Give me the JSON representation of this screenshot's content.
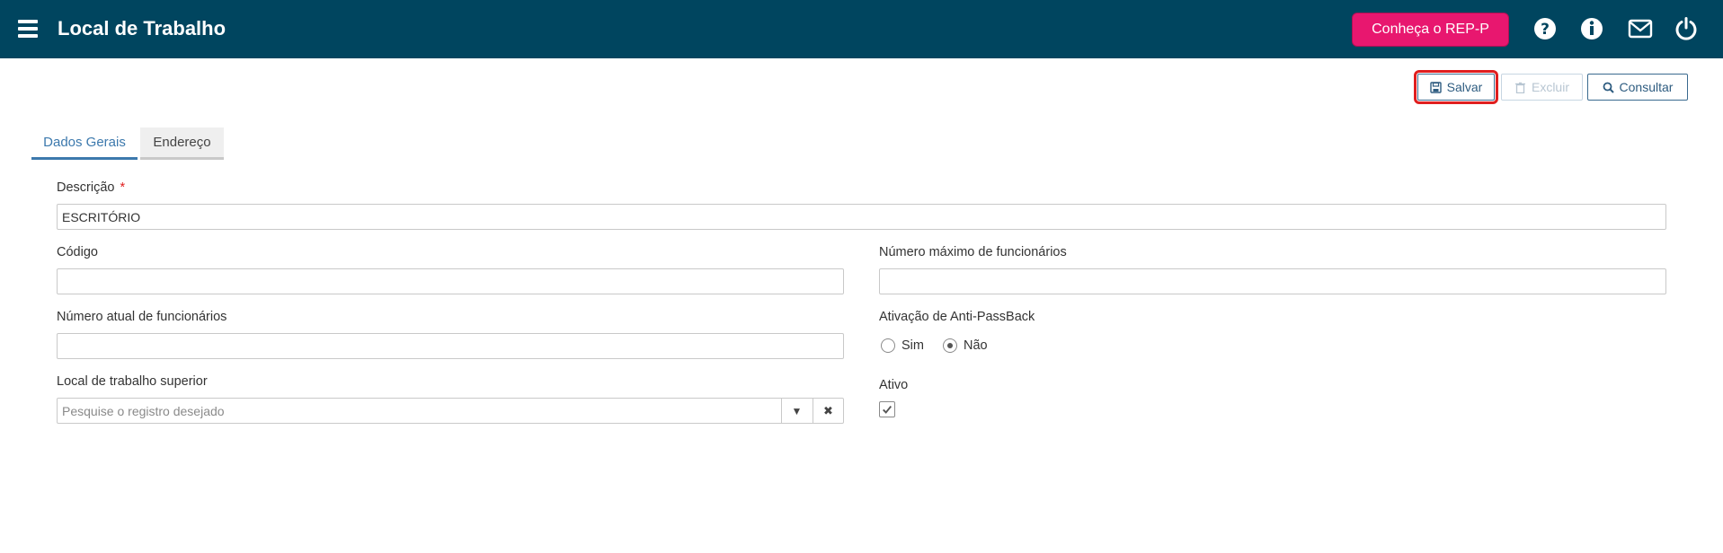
{
  "header": {
    "title": "Local de Trabalho",
    "cta_label": "Conheça o REP-P",
    "background_color": "#00455f",
    "cta_color": "#e8176f",
    "icons": [
      "menu-icon",
      "help-icon",
      "info-icon",
      "mail-icon",
      "power-icon"
    ]
  },
  "toolbar": {
    "save_label": "Salvar",
    "delete_label": "Excluir",
    "search_label": "Consultar"
  },
  "tabs": [
    {
      "label": "Dados Gerais",
      "active": true
    },
    {
      "label": "Endereço",
      "active": false
    }
  ],
  "form": {
    "descricao": {
      "label": "Descrição",
      "required_mark": "*",
      "value": "ESCRITÓRIO"
    },
    "codigo": {
      "label": "Código",
      "value": ""
    },
    "max_funcionarios": {
      "label": "Número máximo de funcionários",
      "value": ""
    },
    "atual_funcionarios": {
      "label": "Número atual de funcionários",
      "value": ""
    },
    "anti_passback": {
      "label": "Ativação de Anti-PassBack",
      "options": [
        "Sim",
        "Não"
      ],
      "selected": "Não"
    },
    "local_superior": {
      "label": "Local de trabalho superior",
      "placeholder": "Pesquise o registro desejado"
    },
    "ativo": {
      "label": "Ativo",
      "checked": true
    }
  }
}
